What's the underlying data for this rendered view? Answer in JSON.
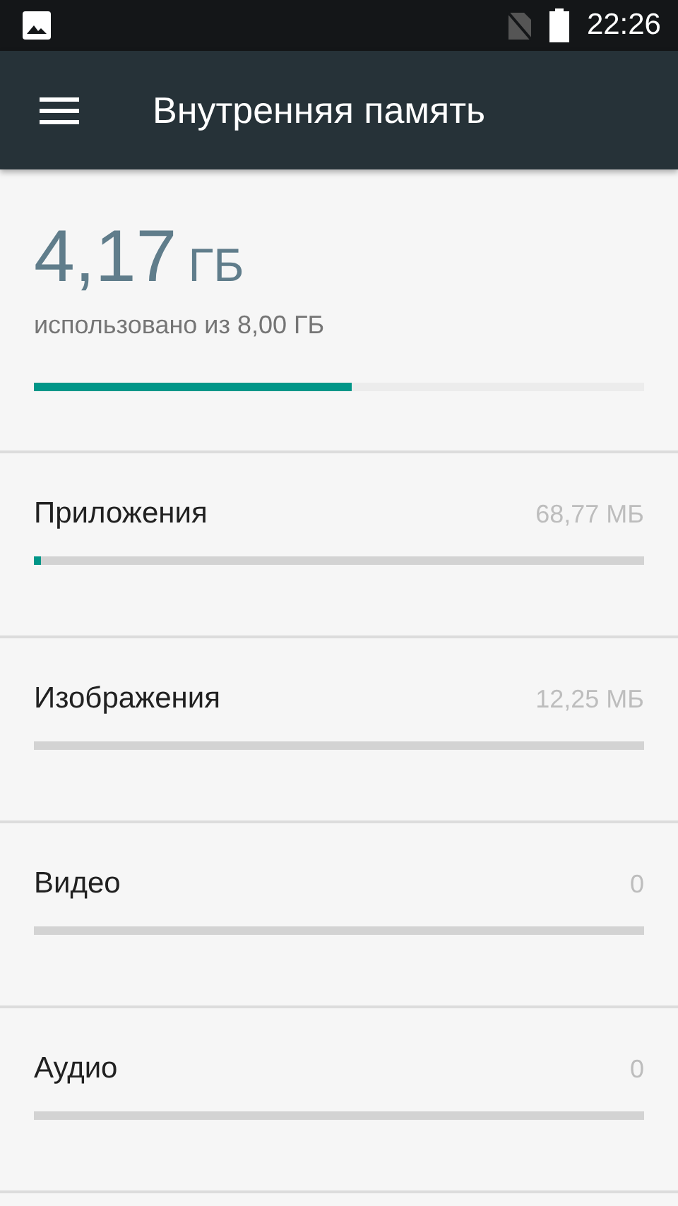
{
  "status_bar": {
    "time": "22:26"
  },
  "toolbar": {
    "title": "Внутренняя память"
  },
  "summary": {
    "amount": "4,17",
    "unit": "ГБ",
    "caption": "использовано из 8,00 ГБ",
    "level": 0.52
  },
  "categories": [
    {
      "name": "Приложения",
      "size": "68,77 МБ",
      "level": 0.012
    },
    {
      "name": "Изображения",
      "size": "12,25 МБ"
    },
    {
      "name": "Видео",
      "size": "0"
    },
    {
      "name": "Аудио",
      "size": "0"
    }
  ]
}
